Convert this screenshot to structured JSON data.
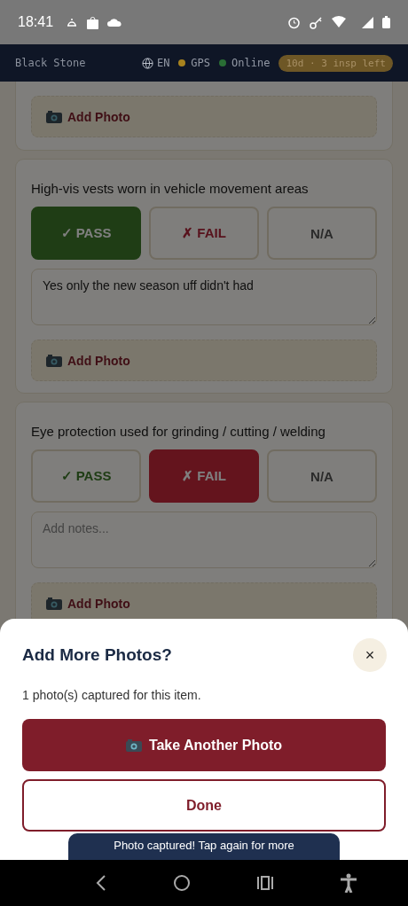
{
  "status_bar": {
    "time": "18:41"
  },
  "header": {
    "brand": "Black Stone",
    "language": "EN",
    "indicators": [
      {
        "label": "GPS",
        "color": "#a8831e"
      },
      {
        "label": "Online",
        "color": "#2a6e35"
      }
    ],
    "badge": "10d · 3 insp left"
  },
  "items": [
    {
      "kind": "partial",
      "photo_button": "Add Photo"
    },
    {
      "kind": "full",
      "question": "High-vis vests worn in vehicle movement areas",
      "options": [
        {
          "kind": "pass",
          "label": "✓ PASS",
          "selected": true
        },
        {
          "kind": "fail",
          "label": "✗ FAIL",
          "selected": false
        },
        {
          "kind": "na",
          "label": "N/A",
          "selected": false
        }
      ],
      "notes": {
        "value": "Yes only the new season uff didn't had"
      },
      "photo_button": "Add Photo"
    },
    {
      "kind": "full",
      "question": "Eye protection used for grinding / cutting / welding",
      "options": [
        {
          "kind": "pass",
          "label": "✓ PASS",
          "selected": false
        },
        {
          "kind": "fail",
          "label": "✗ FAIL",
          "selected": true
        },
        {
          "kind": "na",
          "label": "N/A",
          "selected": false
        }
      ],
      "notes": {
        "placeholder": "Add notes..."
      },
      "photo_button": "Add Photo"
    }
  ],
  "sheet": {
    "title": "Add More Photos?",
    "close": "×",
    "message": "1 photo(s) captured for this item.",
    "primary_button": "Take Another Photo",
    "secondary_button": "Done"
  },
  "toast": "Photo captured! Tap again for more"
}
